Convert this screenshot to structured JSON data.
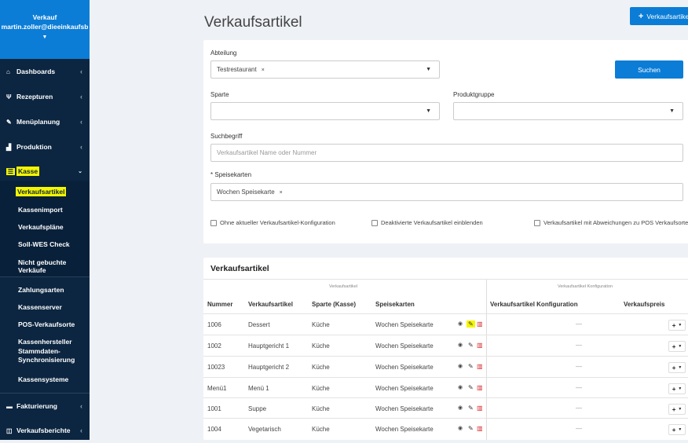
{
  "sidebar": {
    "user_line1": "Verkauf",
    "user_line2": "martin.zoller@dieeinkaufsb",
    "items": [
      {
        "label": "Dashboards",
        "icon": "home-icon"
      },
      {
        "label": "Rezepturen",
        "icon": "cutlery-icon"
      },
      {
        "label": "Menüplanung",
        "icon": "edit-icon"
      },
      {
        "label": "Produktion",
        "icon": "chart-icon"
      },
      {
        "label": "Kasse",
        "icon": "cash-icon"
      }
    ],
    "kasse_sub": [
      "Verkaufsartikel",
      "Kassenimport",
      "Verkaufspläne",
      "Soll-WES Check",
      "Nicht gebuchte Verkäufe"
    ],
    "kasse_sub2": [
      "Zahlungsarten",
      "Kassenserver",
      "POS-Verkaufsorte",
      "Kassenhersteller",
      "Stammdaten-",
      "Synchronisierung",
      "Kassensysteme"
    ],
    "bottom": [
      {
        "label": "Fakturierung",
        "icon": "invoice-icon"
      },
      {
        "label": "Verkaufsberichte",
        "icon": "report-icon"
      }
    ]
  },
  "page": {
    "title": "Verkaufsartikel",
    "add_button": "Verkaufsartikel"
  },
  "filter": {
    "abteilung_label": "Abteilung",
    "abteilung_value": "Testrestaurant",
    "search_button": "Suchen",
    "sparte_label": "Sparte",
    "produktgruppe_label": "Produktgruppe",
    "suchbegriff_label": "Suchbegriff",
    "suchbegriff_placeholder": "Verkaufsartikel Name oder Nummer",
    "speisekarten_label": "Speisekarten",
    "speisekarten_required": "*",
    "speisekarten_value": "Wochen Speisekarte",
    "checkbox1": "Ohne aktueller Verkaufsartikel-Konfiguration",
    "checkbox2": "Deaktivierte Verkaufsartikel einblenden",
    "checkbox3": "Verkaufsartikel mit Abweichungen zu POS Verkaufsorten"
  },
  "table": {
    "title": "Verkaufsartikel",
    "group1": "Verkaufsartikel",
    "group2": "Verkaufsartikel Konfiguration",
    "headers": [
      "Nummer",
      "Verkaufsartikel",
      "Sparte (Kasse)",
      "Speisekarten",
      "Verkaufsartikel Konfiguration",
      "Verkaufspreis"
    ],
    "rows": [
      {
        "nummer": "1006",
        "artikel": "Dessert",
        "sparte": "Küche",
        "speisekarte": "Wochen Speisekarte",
        "konfig": "—"
      },
      {
        "nummer": "1002",
        "artikel": "Hauptgericht 1",
        "sparte": "Küche",
        "speisekarte": "Wochen Speisekarte",
        "konfig": "—"
      },
      {
        "nummer": "10023",
        "artikel": "Hauptgericht 2",
        "sparte": "Küche",
        "speisekarte": "Wochen Speisekarte",
        "konfig": "—"
      },
      {
        "nummer": "Menü1",
        "artikel": "Menü 1",
        "sparte": "Küche",
        "speisekarte": "Wochen Speisekarte",
        "konfig": "—"
      },
      {
        "nummer": "1001",
        "artikel": "Suppe",
        "sparte": "Küche",
        "speisekarte": "Wochen Speisekarte",
        "konfig": "—"
      },
      {
        "nummer": "1004",
        "artikel": "Vegetarisch",
        "sparte": "Küche",
        "speisekarte": "Wochen Speisekarte",
        "konfig": "—"
      }
    ]
  },
  "colors": {
    "accent": "#0b7dd6",
    "sidebar": "#0c2641",
    "highlight": "#f5f500",
    "delete": "#d9262c"
  }
}
